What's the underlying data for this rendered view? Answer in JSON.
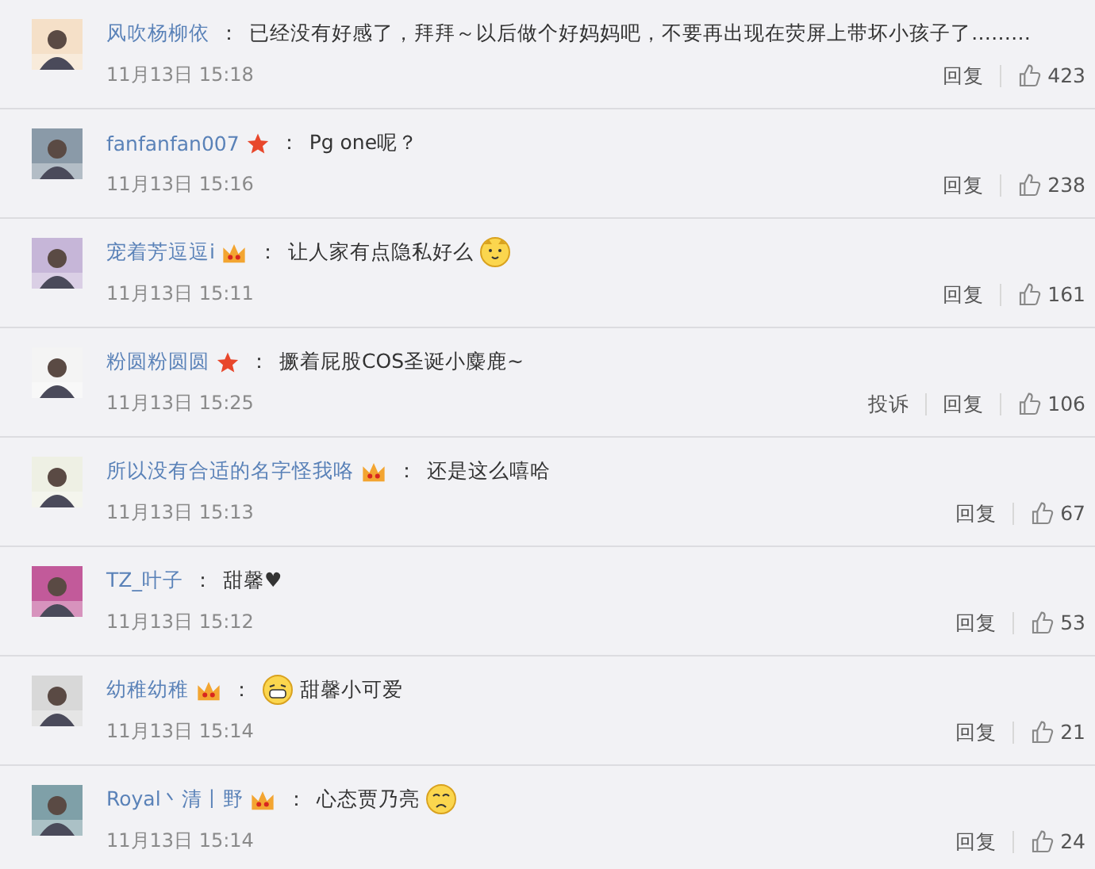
{
  "comments": [
    {
      "user": "风吹杨柳依",
      "separator": "：",
      "content": [
        {
          "kind": "text",
          "text": "已经没有好感了，拜拜～以后做个好妈妈吧，不要再出现在荧屏上带坏小孩子了………"
        }
      ],
      "time": "11月13日 15:18",
      "actions": [
        "回复"
      ],
      "likes": "423"
    },
    {
      "user": "fanfanfan007",
      "badge": {
        "kind": "star"
      },
      "separator": "：",
      "content": [
        {
          "kind": "text",
          "text": "Pg one呢？"
        }
      ],
      "time": "11月13日 15:16",
      "actions": [
        "回复"
      ],
      "likes": "238"
    },
    {
      "user": "宠着芳逗逗i",
      "badge": {
        "kind": "crown"
      },
      "separator": "：",
      "content": [
        {
          "kind": "text",
          "text": "让人家有点隐私好么"
        },
        {
          "kind": "cat"
        }
      ],
      "time": "11月13日 15:11",
      "actions": [
        "回复"
      ],
      "likes": "161"
    },
    {
      "user": "粉圆粉圆圆",
      "badge": {
        "kind": "star"
      },
      "separator": "：",
      "content": [
        {
          "kind": "text",
          "text": "撅着屁股COS圣诞小麋鹿~"
        }
      ],
      "time": "11月13日 15:25",
      "actions": [
        "投诉",
        "回复"
      ],
      "likes": "106"
    },
    {
      "user": "所以没有合适的名字怪我咯",
      "badge": {
        "kind": "crown"
      },
      "separator": "：",
      "content": [
        {
          "kind": "text",
          "text": "还是这么嘻哈"
        }
      ],
      "time": "11月13日 15:13",
      "actions": [
        "回复"
      ],
      "likes": "67"
    },
    {
      "user": "TZ_叶子",
      "separator": "：",
      "content": [
        {
          "kind": "text",
          "text": "甜馨♥"
        }
      ],
      "time": "11月13日 15:12",
      "actions": [
        "回复"
      ],
      "likes": "53"
    },
    {
      "user": "幼稚幼稚",
      "badge": {
        "kind": "crown"
      },
      "separator": "：",
      "content": [
        {
          "kind": "grin"
        },
        {
          "kind": "text",
          "text": "甜馨小可爱"
        }
      ],
      "time": "11月13日 15:14",
      "actions": [
        "回复"
      ],
      "likes": "21"
    },
    {
      "user": "Royal丶清丨野",
      "badge": {
        "kind": "crown"
      },
      "separator": "：",
      "content": [
        {
          "kind": "text",
          "text": "心态贾乃亮"
        },
        {
          "kind": "sad"
        }
      ],
      "time": "11月13日 15:14",
      "actions": [
        "回复"
      ],
      "likes": "24"
    }
  ]
}
